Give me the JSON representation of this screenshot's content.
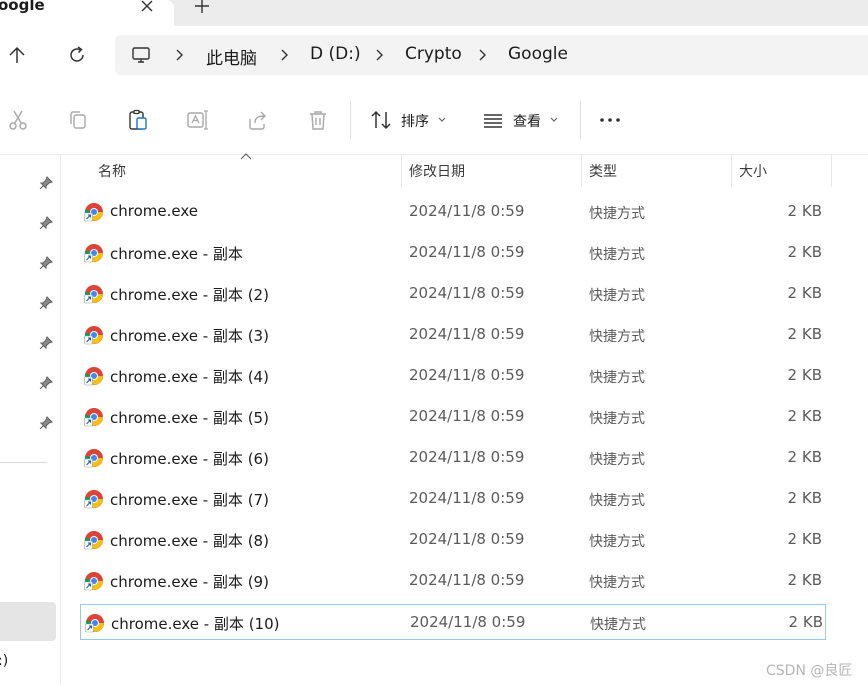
{
  "tab": {
    "title": "oogle"
  },
  "breadcrumb": [
    "此电脑",
    "D (D:)",
    "Crypto",
    "Google"
  ],
  "toolbar": {
    "sort_label": "排序",
    "view_label": "查看"
  },
  "columns": {
    "name": "名称",
    "date": "修改日期",
    "type": "类型",
    "size": "大小"
  },
  "files": [
    {
      "name": "chrome.exe",
      "date": "2024/11/8 0:59",
      "type": "快捷方式",
      "size": "2 KB"
    },
    {
      "name": "chrome.exe - 副本",
      "date": "2024/11/8 0:59",
      "type": "快捷方式",
      "size": "2 KB"
    },
    {
      "name": "chrome.exe - 副本 (2)",
      "date": "2024/11/8 0:59",
      "type": "快捷方式",
      "size": "2 KB"
    },
    {
      "name": "chrome.exe - 副本 (3)",
      "date": "2024/11/8 0:59",
      "type": "快捷方式",
      "size": "2 KB"
    },
    {
      "name": "chrome.exe - 副本 (4)",
      "date": "2024/11/8 0:59",
      "type": "快捷方式",
      "size": "2 KB"
    },
    {
      "name": "chrome.exe - 副本 (5)",
      "date": "2024/11/8 0:59",
      "type": "快捷方式",
      "size": "2 KB"
    },
    {
      "name": "chrome.exe - 副本 (6)",
      "date": "2024/11/8 0:59",
      "type": "快捷方式",
      "size": "2 KB"
    },
    {
      "name": "chrome.exe - 副本 (7)",
      "date": "2024/11/8 0:59",
      "type": "快捷方式",
      "size": "2 KB"
    },
    {
      "name": "chrome.exe - 副本 (8)",
      "date": "2024/11/8 0:59",
      "type": "快捷方式",
      "size": "2 KB"
    },
    {
      "name": "chrome.exe - 副本 (9)",
      "date": "2024/11/8 0:59",
      "type": "快捷方式",
      "size": "2 KB"
    },
    {
      "name": "chrome.exe - 副本 (10)",
      "date": "2024/11/8 0:59",
      "type": "快捷方式",
      "size": "2 KB",
      "selected": true
    }
  ],
  "nav_pane": {
    "drive_label": ":)"
  },
  "watermark": "CSDN @良匠",
  "colors": {
    "selection_border": "#99c8ee",
    "nav_selected": "#e5e5e5",
    "address_bg": "#f3f3f3"
  },
  "icons": [
    "close-icon",
    "plus-icon",
    "arrow-up-icon",
    "refresh-icon",
    "computer-icon",
    "chevron-right-icon",
    "cut-icon",
    "copy-icon",
    "paste-icon",
    "rename-icon",
    "share-icon",
    "delete-icon",
    "sort-icon",
    "view-icon",
    "more-icon",
    "pin-icon",
    "chrome-shortcut-icon"
  ]
}
